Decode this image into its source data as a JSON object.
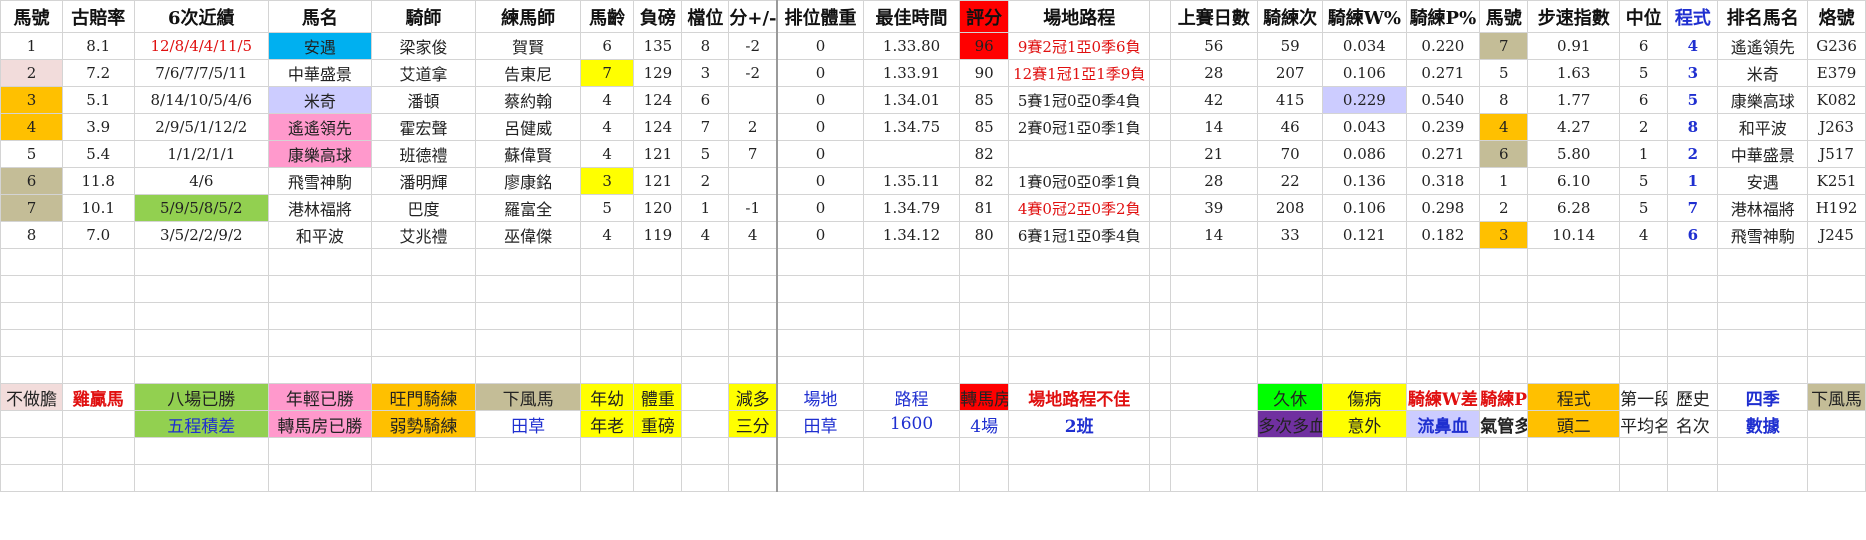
{
  "colors": {
    "red_bg": "#ff0000",
    "yellow": "#ffff00",
    "orange": "#ffc000",
    "pink": "#f2dcdb",
    "cyan": "#00b0f0",
    "lavender": "#ccccff",
    "mag": "#ff99cc",
    "green": "#92d050",
    "tan": "#c4bd97",
    "bright_green": "#00ff00",
    "purple": "#7030a0",
    "blue_text": "#1f2fd0",
    "red_text": "#e01010"
  },
  "headers": [
    "馬號",
    "古賠率",
    "6次近績",
    "馬名",
    "騎師",
    "練馬師",
    "馬齡",
    "負磅",
    "檔位",
    "分+/-",
    "排位體重",
    "最佳時間",
    "評分",
    "場地路程",
    "上賽日數",
    "騎練次",
    "騎練W%",
    "騎練P%",
    "馬號",
    "步速指數",
    "中位",
    "程式",
    "排名馬名",
    "烙號"
  ],
  "rows": [
    [
      "1",
      "8.1",
      "12/8/4/4/11/5",
      "安遇",
      "梁家俊",
      "賀賢",
      "6",
      "135",
      "8",
      "-2",
      "0",
      "1.33.80",
      "96",
      "9賽2冠1亞0季6負",
      "56",
      "59",
      "0.034",
      "0.220",
      "7",
      "0.91",
      "6",
      "4",
      "遙遙領先",
      "G236"
    ],
    [
      "2",
      "7.2",
      "7/6/7/7/5/11",
      "中華盛景",
      "艾道拿",
      "告東尼",
      "7",
      "129",
      "3",
      "-2",
      "0",
      "1.33.91",
      "90",
      "12賽1冠1亞1季9負",
      "28",
      "207",
      "0.106",
      "0.271",
      "5",
      "1.63",
      "5",
      "3",
      "米奇",
      "E379"
    ],
    [
      "3",
      "5.1",
      "8/14/10/5/4/6",
      "米奇",
      "潘頓",
      "蔡約翰",
      "4",
      "124",
      "6",
      "",
      "0",
      "1.34.01",
      "85",
      "5賽1冠0亞0季4負",
      "42",
      "415",
      "0.229",
      "0.540",
      "8",
      "1.77",
      "6",
      "5",
      "康樂高球",
      "K082"
    ],
    [
      "4",
      "3.9",
      "2/9/5/1/12/2",
      "遙遙領先",
      "霍宏聲",
      "呂健威",
      "4",
      "124",
      "7",
      "2",
      "0",
      "1.34.75",
      "85",
      "2賽0冠1亞0季1負",
      "14",
      "46",
      "0.043",
      "0.239",
      "4",
      "4.27",
      "2",
      "8",
      "和平波",
      "J263"
    ],
    [
      "5",
      "5.4",
      "1/1/2/1/1",
      "康樂高球",
      "班德禮",
      "蘇偉賢",
      "4",
      "121",
      "5",
      "7",
      "0",
      "",
      "82",
      "",
      "21",
      "70",
      "0.086",
      "0.271",
      "6",
      "5.80",
      "1",
      "2",
      "中華盛景",
      "J517"
    ],
    [
      "6",
      "11.8",
      "4/6",
      "飛雪神駒",
      "潘明輝",
      "廖康銘",
      "3",
      "121",
      "2",
      "",
      "0",
      "1.35.11",
      "82",
      "1賽0冠0亞0季1負",
      "28",
      "22",
      "0.136",
      "0.318",
      "1",
      "6.10",
      "5",
      "1",
      "安遇",
      "K251"
    ],
    [
      "7",
      "10.1",
      "5/9/5/8/5/2",
      "港林福將",
      "巴度",
      "羅富全",
      "5",
      "120",
      "1",
      "-1",
      "0",
      "1.34.79",
      "81",
      "4賽0冠2亞0季2負",
      "39",
      "208",
      "0.106",
      "0.298",
      "2",
      "6.28",
      "5",
      "7",
      "港林福將",
      "H192"
    ],
    [
      "8",
      "7.0",
      "3/5/2/2/9/2",
      "和平波",
      "艾兆禮",
      "巫偉傑",
      "4",
      "119",
      "4",
      "4",
      "0",
      "1.34.12",
      "80",
      "6賽1冠1亞0季4負",
      "14",
      "33",
      "0.121",
      "0.182",
      "3",
      "10.14",
      "4",
      "6",
      "飛雪神駒",
      "J245"
    ]
  ],
  "legend": {
    "row1": [
      "不做膽",
      "雞贏馬",
      "八場已勝",
      "年輕已勝",
      "旺門騎練",
      "下風馬",
      "年幼",
      "體重",
      "",
      "減多",
      "場地",
      "路程",
      "轉馬房",
      "場地路程不佳",
      "",
      "久休",
      "傷病",
      "騎練W差",
      "騎練P差",
      "程式",
      "第一段",
      "歷史",
      "四季",
      "下風馬"
    ],
    "row2": [
      "",
      "",
      "五程積差",
      "轉馬房已勝",
      "弱勢騎練",
      "田草",
      "年老",
      "重磅",
      "",
      "三分",
      "田草",
      "1600",
      "4場",
      "2班",
      "",
      "多次多血",
      "意外",
      "流鼻血",
      "氣管多血",
      "頭二",
      "平均名次",
      "名次",
      "數據",
      ""
    ]
  }
}
